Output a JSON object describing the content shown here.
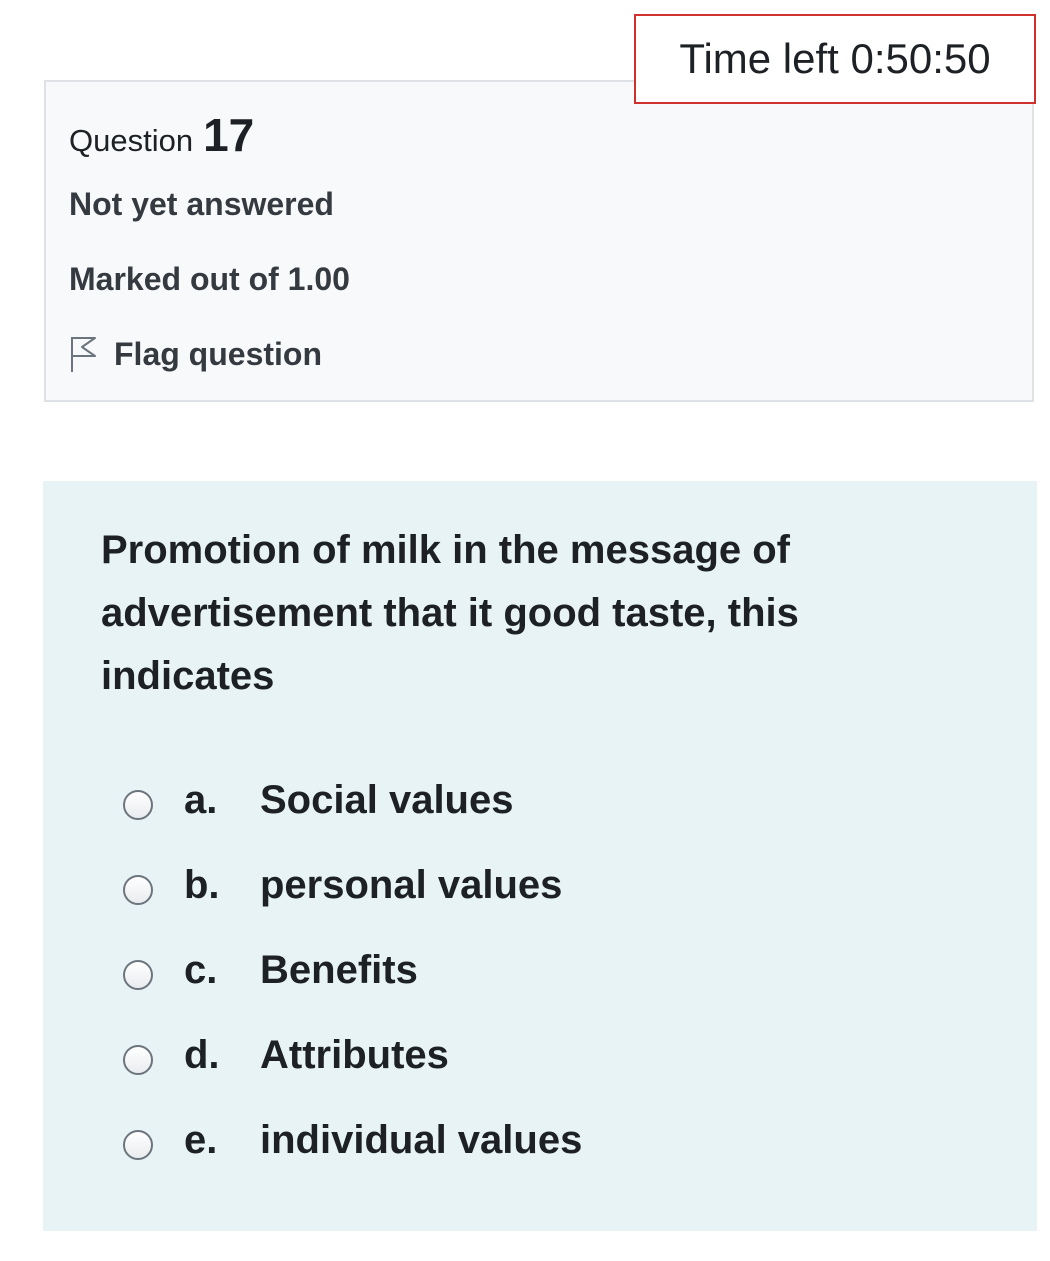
{
  "timer": {
    "text": "Time left 0:50:50"
  },
  "question_info": {
    "label": "Question",
    "number": "17",
    "state": "Not yet answered",
    "grade": "Marked out of 1.00",
    "flag_label": "Flag question",
    "flag_icon": "flag-outline-icon"
  },
  "question": {
    "text": "Promotion of milk in the message of advertisement that it good taste, this indicates",
    "answers": [
      {
        "letter": "a.",
        "text": "Social values"
      },
      {
        "letter": "b.",
        "text": "personal values"
      },
      {
        "letter": "c.",
        "text": "Benefits"
      },
      {
        "letter": "d.",
        "text": "Attributes"
      },
      {
        "letter": "e.",
        "text": "individual values"
      }
    ]
  },
  "colors": {
    "timer_border": "#d0312d",
    "info_background": "#f8f9fa",
    "content_background": "#e7f3f5"
  }
}
